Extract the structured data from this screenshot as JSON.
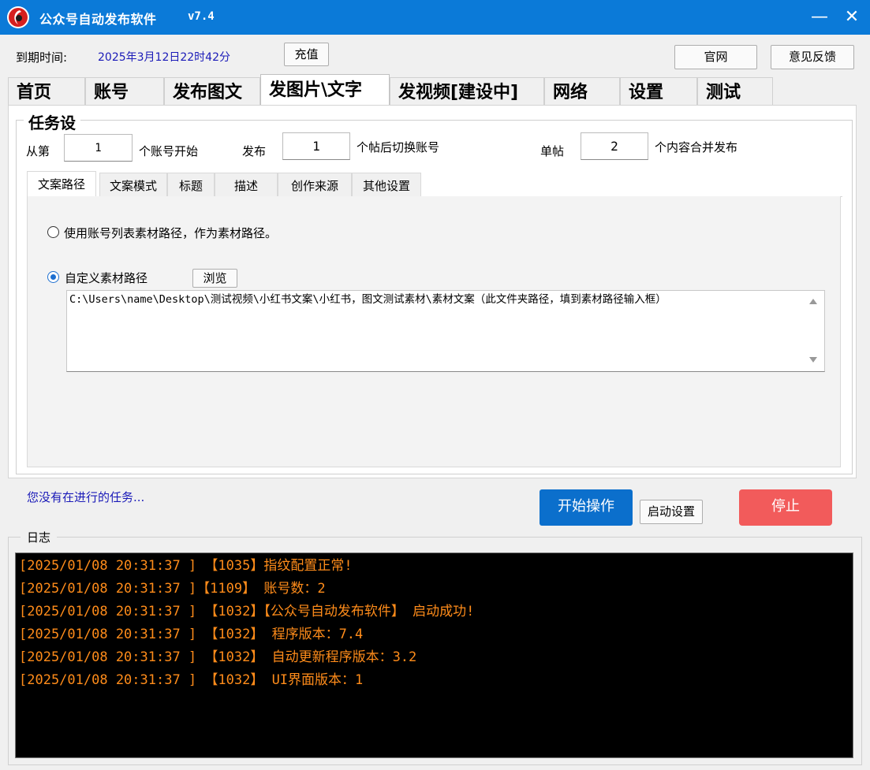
{
  "window": {
    "title": "公众号自动发布软件",
    "version": "v7.4",
    "minimize": "—",
    "close": "✕",
    "logo_icon": "app-logo-icon"
  },
  "top": {
    "expire_label": "到期时间:",
    "expire_value": "2025年3月12日22时42分",
    "recharge": "充值",
    "website": "官网",
    "feedback": "意见反馈"
  },
  "tabs": [
    {
      "label": "首页",
      "active": false
    },
    {
      "label": "账号",
      "active": false
    },
    {
      "label": "发布图文",
      "active": false
    },
    {
      "label": "发图片\\文字",
      "active": true
    },
    {
      "label": "发视频[建设中]",
      "active": false
    },
    {
      "label": "网络",
      "active": false
    },
    {
      "label": "设置",
      "active": false
    },
    {
      "label": "测试",
      "active": false
    }
  ],
  "task": {
    "legend": "任务设",
    "from_label": "从第",
    "from_value": "1",
    "from_suffix": "个账号开始",
    "publish_label": "发布",
    "publish_value": "1",
    "publish_suffix": "个帖后切换账号",
    "single_label": "单帖",
    "single_value": "2",
    "single_suffix": "个内容合并发布"
  },
  "subtabs": [
    {
      "label": "文案路径",
      "active": true
    },
    {
      "label": "文案模式",
      "active": false
    },
    {
      "label": "标题",
      "active": false
    },
    {
      "label": "描述",
      "active": false
    },
    {
      "label": "创作来源",
      "active": false
    },
    {
      "label": "其他设置",
      "active": false
    }
  ],
  "path": {
    "option1": "使用账号列表素材路径，作为素材路径。",
    "option1_checked": false,
    "option2": "自定义素材路径",
    "option2_checked": true,
    "browse": "浏览",
    "value": "C:\\Users\\name\\Desktop\\测试视频\\小红书文案\\小红书，图文测试素材\\素材文案（此文件夹路径，填到素材路径输入框）"
  },
  "status": {
    "text": "您没有在进行的任务...",
    "start": "开始操作",
    "startup_settings": "启动设置",
    "stop": "停止"
  },
  "log": {
    "legend": "日志",
    "lines": [
      "[2025/01/08 20:31:37 ] 【1035】指纹配置正常!",
      "[2025/01/08 20:31:37 ]【1109】 账号数：2",
      "[2025/01/08 20:31:37 ] 【1032】【公众号自动发布软件】 启动成功!",
      "[2025/01/08 20:31:37 ] 【1032】 程序版本：7.4",
      "[2025/01/08 20:31:37 ] 【1032】 自动更新程序版本：3.2",
      "[2025/01/08 20:31:37 ] 【1032】 UI界面版本：1"
    ],
    "text_color": "#ff8c1a"
  },
  "colors": {
    "titlebar": "#0b7ad8",
    "start_button": "#0b6fcc",
    "stop_button": "#f25b5b",
    "link_blue": "#1a1ab8"
  }
}
